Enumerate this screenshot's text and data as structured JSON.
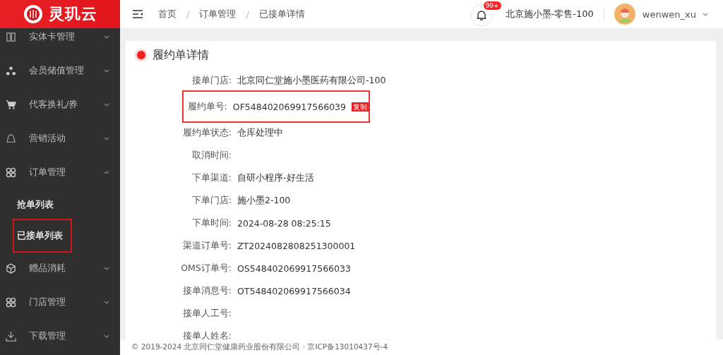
{
  "logo": {
    "text": "灵玑云"
  },
  "breadcrumb": [
    {
      "label": "首页"
    },
    {
      "separator": "/",
      "label": "订单管理"
    },
    {
      "separator": "/",
      "label": "已接单详情"
    }
  ],
  "header": {
    "notification_badge": "99+",
    "store": "北京施小墨-零售-100",
    "user": "wenwen_xu"
  },
  "sidebar": {
    "items": [
      {
        "label": "实体卡管理",
        "expanded": false
      },
      {
        "label": "会员储值管理",
        "expanded": false
      },
      {
        "label": "代客换礼/券",
        "expanded": false
      },
      {
        "label": "营销活动",
        "expanded": false
      },
      {
        "label": "订单管理",
        "expanded": true,
        "children": [
          {
            "label": "抢单列表",
            "highlighted": false
          },
          {
            "label": "已接单列表",
            "highlighted": true
          }
        ]
      },
      {
        "label": "赠品消耗",
        "expanded": false
      },
      {
        "label": "门店管理",
        "expanded": false
      },
      {
        "label": "下载管理",
        "expanded": false
      }
    ]
  },
  "detail": {
    "title": "履约单详情",
    "rows": [
      {
        "label": "接单门店:",
        "value": "北京同仁堂施小墨医药有限公司-100",
        "highlighted": false
      },
      {
        "label": "履约单号:",
        "value": "OF548402069917566039",
        "action": "复制",
        "highlighted": true
      },
      {
        "label": "履约单状态:",
        "value": "仓库处理中",
        "highlighted": false
      },
      {
        "label": "取消时间:",
        "highlighted": false
      },
      {
        "label": "下单渠道:",
        "value": "自研小程序-好生活",
        "highlighted": false
      },
      {
        "label": "下单门店:",
        "value": "施小墨2-100",
        "highlighted": false
      },
      {
        "label": "下单时间:",
        "value": "2024-08-28 08:25:15",
        "highlighted": false
      },
      {
        "label": "渠道订单号:",
        "value": "ZT2024082808251300001",
        "highlighted": false
      },
      {
        "label": "OMS订单号:",
        "value": "OS548402069917566033",
        "highlighted": false
      },
      {
        "label": "接单消息号:",
        "value": "OT548402069917566034",
        "highlighted": false
      },
      {
        "label": "接单人工号:",
        "highlighted": false
      },
      {
        "label": "接单人姓名:",
        "highlighted": false
      }
    ]
  },
  "footer": "© 2019-2024 北京同仁堂健康药业股份有限公司 · 京ICP备13010437号-4"
}
